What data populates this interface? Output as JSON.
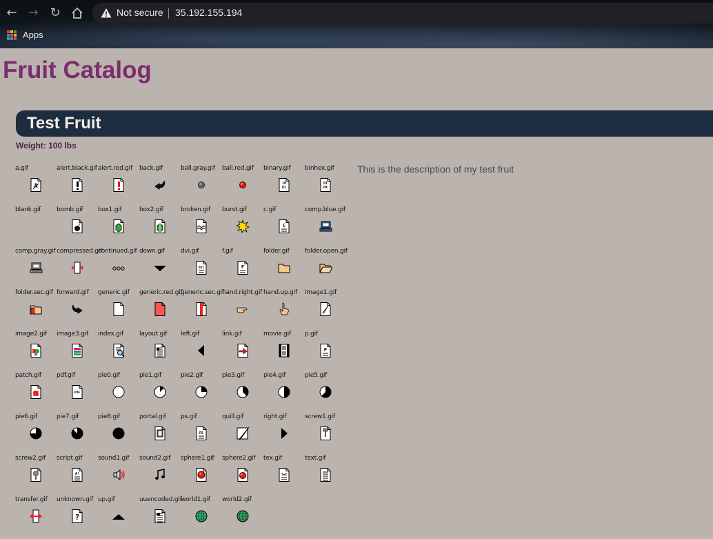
{
  "browser": {
    "security_label": "Not secure",
    "url": "35.192.155.194",
    "bookmarks": [
      {
        "label": "Apps",
        "icon": "apps-grid-icon"
      }
    ]
  },
  "page": {
    "title": "Fruit Catalog",
    "product": {
      "name": "Test Fruit",
      "weight": "Weight: 100 lbs",
      "description": "This is the description of my test fruit"
    }
  },
  "icons": [
    {
      "file": "a.gif",
      "icon": "a"
    },
    {
      "file": "alert.black.gif",
      "icon": "alert-black"
    },
    {
      "file": "alert.red.gif",
      "icon": "alert-red"
    },
    {
      "file": "back.gif",
      "icon": "back"
    },
    {
      "file": "ball.gray.gif",
      "icon": "ball-gray"
    },
    {
      "file": "ball.red.gif",
      "icon": "ball-red"
    },
    {
      "file": "binary.gif",
      "icon": "binary"
    },
    {
      "file": "binhex.gif",
      "icon": "binhex"
    },
    {
      "file": "blank.gif",
      "icon": "blank"
    },
    {
      "file": "bomb.gif",
      "icon": "bomb"
    },
    {
      "file": "box1.gif",
      "icon": "box1"
    },
    {
      "file": "box2.gif",
      "icon": "box2"
    },
    {
      "file": "broken.gif",
      "icon": "broken"
    },
    {
      "file": "burst.gif",
      "icon": "burst"
    },
    {
      "file": "c.gif",
      "icon": "c"
    },
    {
      "file": "comp.blue.gif",
      "icon": "comp-blue"
    },
    {
      "file": "comp.gray.gif",
      "icon": "comp-gray"
    },
    {
      "file": "compressed.gif",
      "icon": "compressed"
    },
    {
      "file": "continued.gif",
      "icon": "continued"
    },
    {
      "file": "down.gif",
      "icon": "down"
    },
    {
      "file": "dvi.gif",
      "icon": "dvi"
    },
    {
      "file": "f.gif",
      "icon": "f"
    },
    {
      "file": "folder.gif",
      "icon": "folder"
    },
    {
      "file": "folder.open.gif",
      "icon": "folder-open"
    },
    {
      "file": "folder.sec.gif",
      "icon": "folder-sec"
    },
    {
      "file": "forward.gif",
      "icon": "forward"
    },
    {
      "file": "generic.gif",
      "icon": "generic"
    },
    {
      "file": "generic.red.gif",
      "icon": "generic-red"
    },
    {
      "file": "generic.sec.gif",
      "icon": "generic-sec"
    },
    {
      "file": "hand.right.gif",
      "icon": "hand-right"
    },
    {
      "file": "hand.up.gif",
      "icon": "hand-up"
    },
    {
      "file": "image1.gif",
      "icon": "image1"
    },
    {
      "file": "image2.gif",
      "icon": "image2"
    },
    {
      "file": "image3.gif",
      "icon": "image3"
    },
    {
      "file": "index.gif",
      "icon": "index"
    },
    {
      "file": "layout.gif",
      "icon": "layout"
    },
    {
      "file": "left.gif",
      "icon": "left"
    },
    {
      "file": "link.gif",
      "icon": "link"
    },
    {
      "file": "movie.gif",
      "icon": "movie"
    },
    {
      "file": "p.gif",
      "icon": "p"
    },
    {
      "file": "patch.gif",
      "icon": "patch"
    },
    {
      "file": "pdf.gif",
      "icon": "pdf"
    },
    {
      "file": "pie0.gif",
      "icon": "pie",
      "pie_eighths": 0
    },
    {
      "file": "pie1.gif",
      "icon": "pie",
      "pie_eighths": 1
    },
    {
      "file": "pie2.gif",
      "icon": "pie",
      "pie_eighths": 2
    },
    {
      "file": "pie3.gif",
      "icon": "pie",
      "pie_eighths": 3
    },
    {
      "file": "pie4.gif",
      "icon": "pie",
      "pie_eighths": 4
    },
    {
      "file": "pie5.gif",
      "icon": "pie",
      "pie_eighths": 5
    },
    {
      "file": "pie6.gif",
      "icon": "pie",
      "pie_eighths": 6
    },
    {
      "file": "pie7.gif",
      "icon": "pie",
      "pie_eighths": 7
    },
    {
      "file": "pie8.gif",
      "icon": "pie",
      "pie_eighths": 8
    },
    {
      "file": "portal.gif",
      "icon": "portal"
    },
    {
      "file": "ps.gif",
      "icon": "ps"
    },
    {
      "file": "quill.gif",
      "icon": "quill"
    },
    {
      "file": "right.gif",
      "icon": "right"
    },
    {
      "file": "screw1.gif",
      "icon": "screw1"
    },
    {
      "file": "screw2.gif",
      "icon": "screw2"
    },
    {
      "file": "script.gif",
      "icon": "script"
    },
    {
      "file": "sound1.gif",
      "icon": "sound1"
    },
    {
      "file": "sound2.gif",
      "icon": "sound2"
    },
    {
      "file": "sphere1.gif",
      "icon": "sphere1"
    },
    {
      "file": "sphere2.gif",
      "icon": "sphere2"
    },
    {
      "file": "tex.gif",
      "icon": "tex"
    },
    {
      "file": "text.gif",
      "icon": "text"
    },
    {
      "file": "transfer.gif",
      "icon": "transfer"
    },
    {
      "file": "unknown.gif",
      "icon": "unknown"
    },
    {
      "file": "up.gif",
      "icon": "up"
    },
    {
      "file": "uuencoded.gif",
      "icon": "uuencoded"
    },
    {
      "file": "world1.gif",
      "icon": "world1"
    },
    {
      "file": "world2.gif",
      "icon": "world2"
    }
  ]
}
